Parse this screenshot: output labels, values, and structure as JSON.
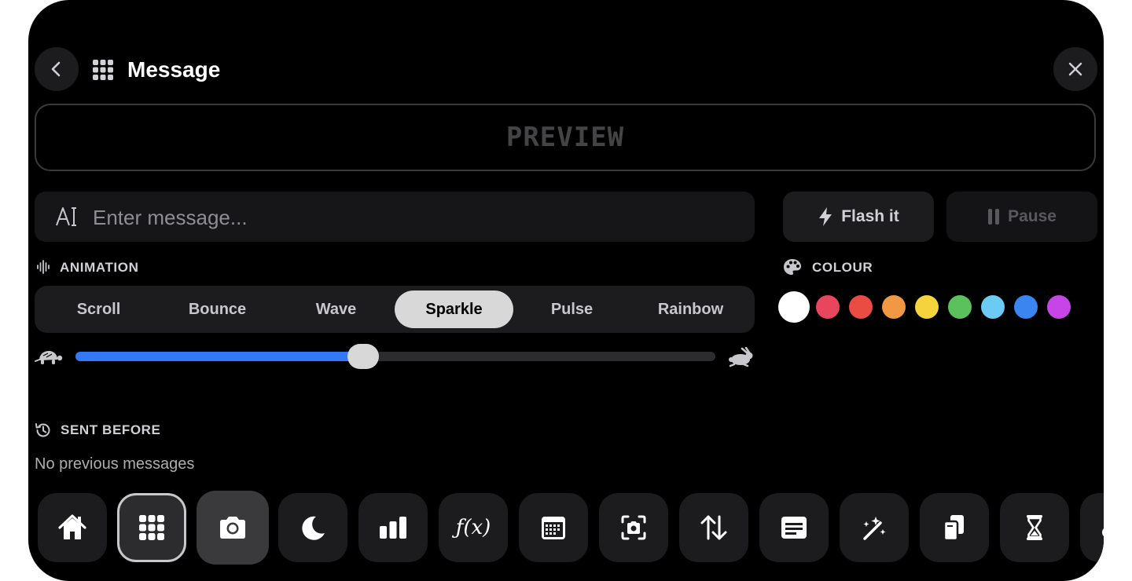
{
  "header": {
    "title": "Message",
    "icons": {
      "back": "chevron-left-icon",
      "app": "grid-icon",
      "close": "close-icon"
    }
  },
  "preview": {
    "text": "PREVIEW"
  },
  "message_input": {
    "value": "",
    "placeholder": "Enter message...",
    "icon": "text-cursor-icon"
  },
  "actions": {
    "flash_label": "Flash it",
    "pause_label": "Pause"
  },
  "animation": {
    "label": "ANIMATION",
    "options": [
      "Scroll",
      "Bounce",
      "Wave",
      "Sparkle",
      "Pulse",
      "Rainbow"
    ],
    "selected": "Sparkle",
    "speed": 0.45,
    "speed_icons": [
      "turtle-icon",
      "rabbit-icon"
    ]
  },
  "colour": {
    "label": "COLOUR",
    "swatches": [
      "#ffffff",
      "#e8455e",
      "#ea4b43",
      "#f09843",
      "#f5d33f",
      "#5ac15c",
      "#6ccbf3",
      "#3a86f1",
      "#c744e6"
    ],
    "selected": "#ffffff"
  },
  "history": {
    "label": "SENT BEFORE",
    "empty_text": "No previous messages"
  },
  "dock": {
    "items": [
      "home-icon",
      "grid-icon",
      "camera-icon",
      "moon-icon",
      "bar-chart-icon",
      "function-icon",
      "calendar-icon",
      "screenshot-icon",
      "arrows-up-down-icon",
      "message-icon",
      "magic-wand-icon",
      "copy-icon",
      "hourglass-icon",
      "cloud-icon"
    ],
    "selected": "grid-icon",
    "function_label": "ƒ(x)"
  },
  "colors": {
    "accent": "#3478f6",
    "background": "#000000",
    "surface": "#1c1c1e"
  }
}
